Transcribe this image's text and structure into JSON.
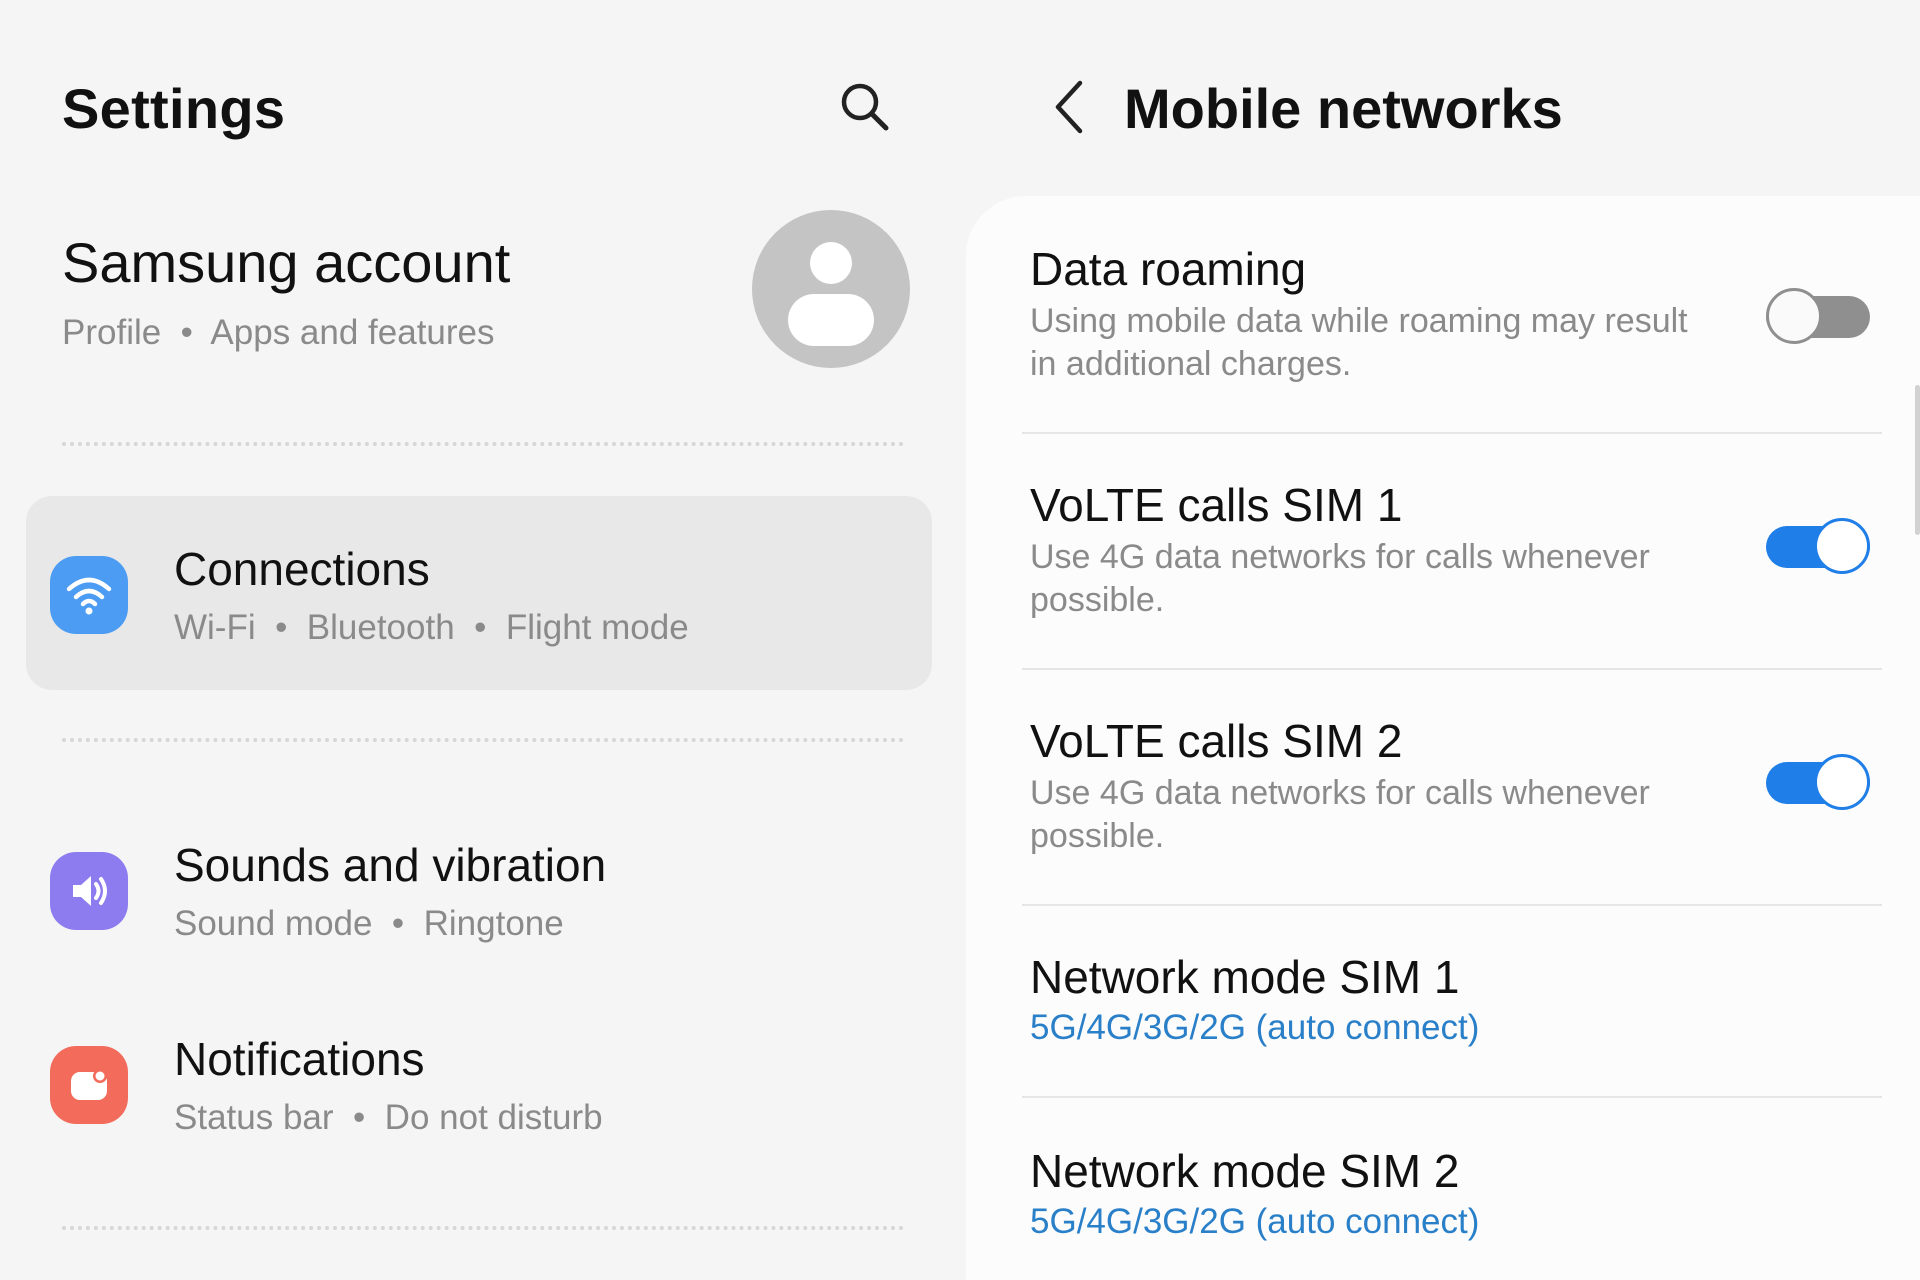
{
  "settings": {
    "title": "Settings",
    "search_icon": "search-icon",
    "account": {
      "name": "Samsung account",
      "subtitle": "Profile  •  Apps and features",
      "avatar_icon": "person-icon"
    },
    "items": [
      {
        "id": "connections",
        "title": "Connections",
        "subtitle": "Wi-Fi  •  Bluetooth  •  Flight mode",
        "icon": "wifi-icon",
        "color": "#4b9cf2",
        "active": true
      },
      {
        "id": "sounds",
        "title": "Sounds and vibration",
        "subtitle": "Sound mode  •  Ringtone",
        "icon": "speaker-icon",
        "color": "#8d7cf0",
        "active": false
      },
      {
        "id": "notifications",
        "title": "Notifications",
        "subtitle": "Status bar  •  Do not disturb",
        "icon": "notification-icon",
        "color": "#f26b5b",
        "active": false
      }
    ]
  },
  "mobile_networks": {
    "title": "Mobile networks",
    "back_icon": "back-arrow-icon",
    "rows": [
      {
        "title": "Data roaming",
        "description": "Using mobile data while roaming may result in additional charges.",
        "toggle": false
      },
      {
        "title": "VoLTE calls SIM 1",
        "description": "Use 4G data networks for calls whenever possible.",
        "toggle": true
      },
      {
        "title": "VoLTE calls SIM 2",
        "description": "Use 4G data networks for calls whenever possible.",
        "toggle": true
      },
      {
        "title": "Network mode SIM 1",
        "value": "5G/4G/3G/2G (auto connect)"
      },
      {
        "title": "Network mode SIM 2",
        "value": "5G/4G/3G/2G (auto connect)"
      }
    ]
  },
  "colors": {
    "accent": "#1f7ee8",
    "link_value": "#2a7fc9",
    "toggle_off": "#8f8f8f"
  }
}
